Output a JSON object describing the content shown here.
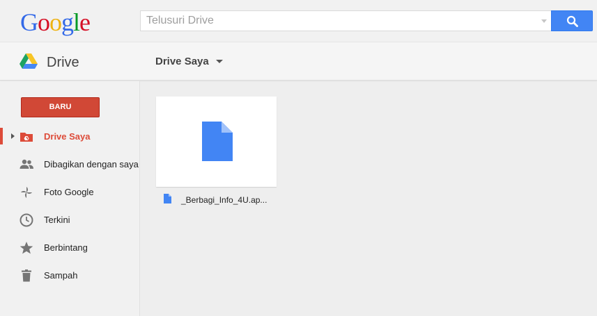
{
  "header": {
    "logo_letters": [
      {
        "ch": "G",
        "color": "#3369e8"
      },
      {
        "ch": "o",
        "color": "#d50f25"
      },
      {
        "ch": "o",
        "color": "#eeb211"
      },
      {
        "ch": "g",
        "color": "#3369e8"
      },
      {
        "ch": "l",
        "color": "#009925"
      },
      {
        "ch": "e",
        "color": "#d50f25"
      }
    ],
    "search_placeholder": "Telusuri Drive",
    "search_button_icon": "search-icon"
  },
  "appbar": {
    "title": "Drive",
    "location_menu": "Drive Saya"
  },
  "sidebar": {
    "new_button": "BARU",
    "items": [
      {
        "label": "Drive Saya",
        "icon": "drive-folder-icon",
        "active": true
      },
      {
        "label": "Dibagikan dengan saya",
        "icon": "people-icon",
        "active": false
      },
      {
        "label": "Foto Google",
        "icon": "pinwheel-icon",
        "active": false
      },
      {
        "label": "Terkini",
        "icon": "clock-icon",
        "active": false
      },
      {
        "label": "Berbintang",
        "icon": "star-icon",
        "active": false
      },
      {
        "label": "Sampah",
        "icon": "trash-icon",
        "active": false
      }
    ]
  },
  "files": [
    {
      "name": "_Berbagi_Info_4U.ap...",
      "icon": "doc-file-icon"
    }
  ],
  "colors": {
    "accent_red": "#dd4b39",
    "search_blue": "#4285f4",
    "doc_blue": "#4285f4"
  }
}
